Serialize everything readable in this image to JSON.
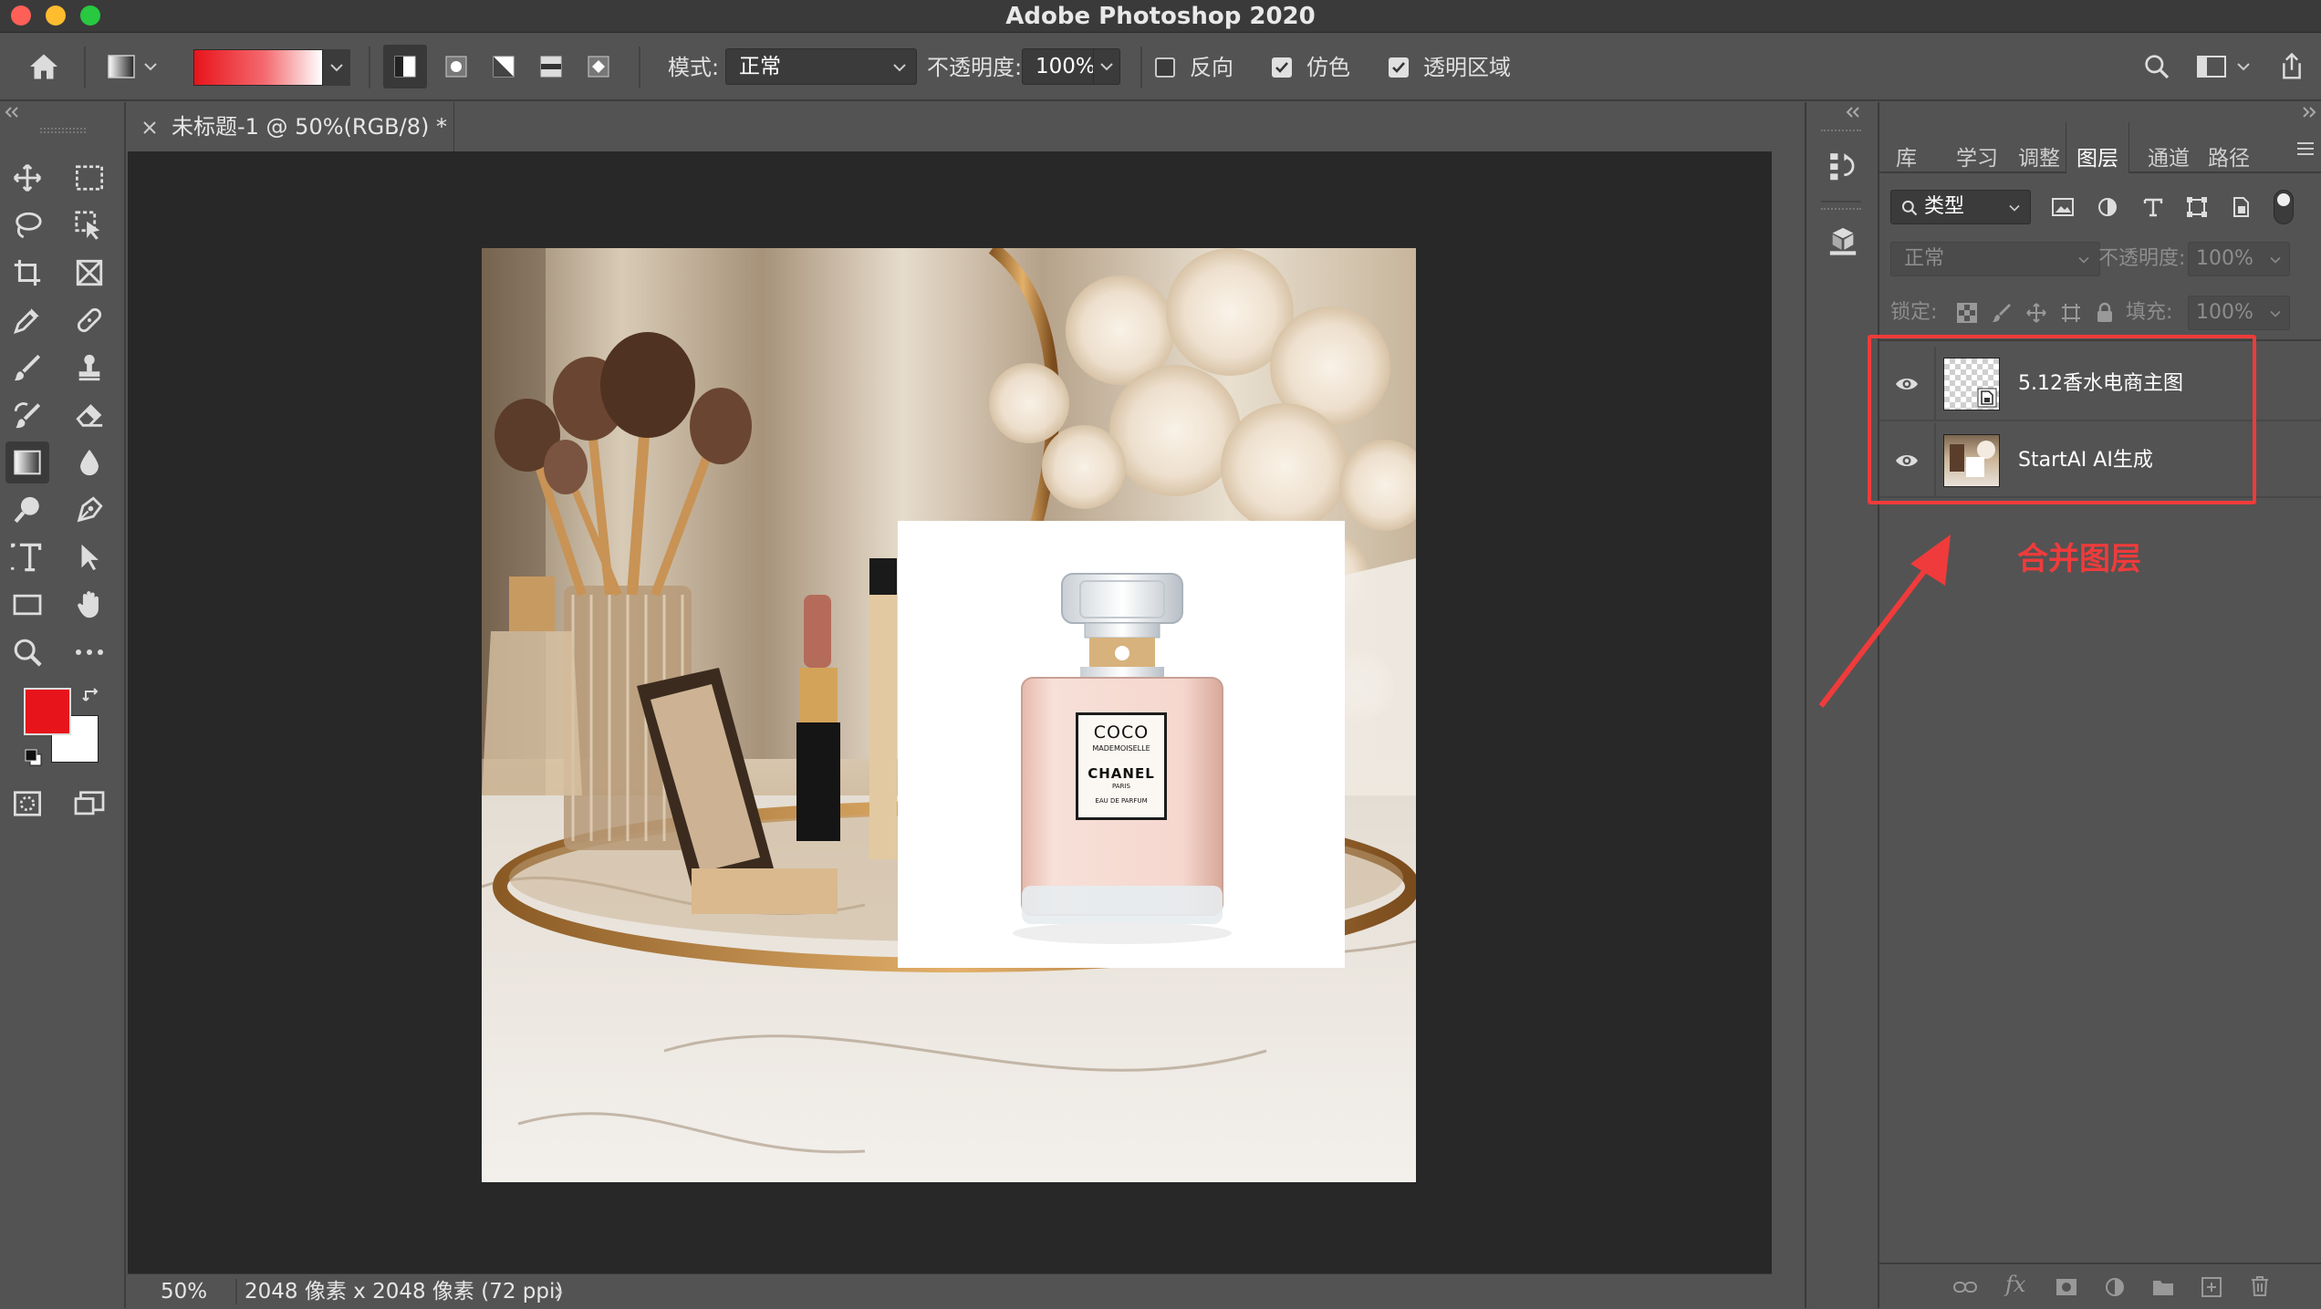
{
  "app": {
    "title": "Adobe Photoshop 2020"
  },
  "options": {
    "mode_label": "模式:",
    "mode_value": "正常",
    "opacity_label": "不透明度:",
    "opacity_value": "100%",
    "reverse_label": "反向",
    "reverse_checked": false,
    "dither_label": "仿色",
    "dither_checked": true,
    "transparency_label": "透明区域",
    "transparency_checked": true,
    "gradient_colors": [
      "#e8141b",
      "#ffffff"
    ]
  },
  "document": {
    "tab_label": "未标题-1 @ 50%(RGB/8) *"
  },
  "status": {
    "zoom": "50%",
    "doc_info": "2048 像素 x 2048 像素 (72 ppi)"
  },
  "colors": {
    "foreground": "#e8141b",
    "background": "#ffffff",
    "annotation": "#ef3b3b"
  },
  "panel": {
    "tabs": [
      "库",
      "学习",
      "调整",
      "图层",
      "通道",
      "路径"
    ],
    "active_tab": "图层",
    "filter_label": "类型",
    "blend_mode": "正常",
    "opacity_label": "不透明度:",
    "opacity_value": "100%",
    "lock_label": "锁定:",
    "fill_label": "填充:",
    "fill_value": "100%",
    "layers": [
      {
        "name": "5.12香水电商主图",
        "visible": true
      },
      {
        "name": "StartAI AI生成",
        "visible": true
      }
    ]
  },
  "annotation": {
    "text": "合并图层"
  },
  "product": {
    "brand_line1": "COCO",
    "brand_line2": "MADEMOISELLE",
    "brand_line3": "CHANEL",
    "brand_line4": "PARIS",
    "brand_line5": "EAU DE PARFUM"
  }
}
